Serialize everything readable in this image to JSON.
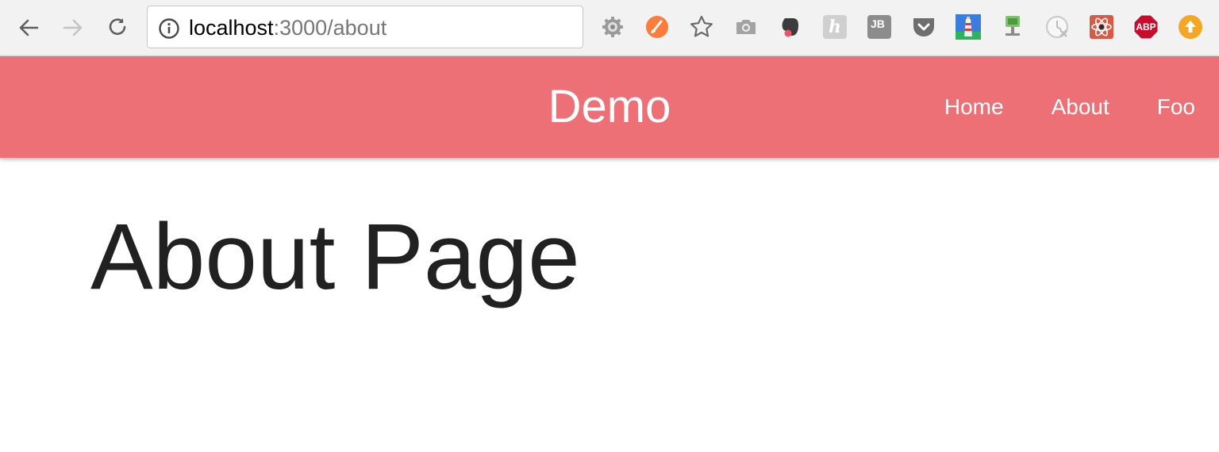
{
  "browser": {
    "url_host": "localhost",
    "url_rest": ":3000/about",
    "extensions": [
      {
        "icon": "settings-gear-icon"
      },
      {
        "icon": "orange-brush-icon",
        "color": "#fc7c3c"
      },
      {
        "icon": "star-bookmark-icon"
      },
      {
        "icon": "camera-icon"
      },
      {
        "icon": "evernote-elephant-icon"
      },
      {
        "icon": "honey-h-icon",
        "label": "h"
      },
      {
        "icon": "jetbrains-icon",
        "label": "JB"
      },
      {
        "icon": "pocket-icon"
      },
      {
        "icon": "lighthouse-icon"
      },
      {
        "icon": "network-monitor-icon"
      },
      {
        "icon": "clock-disabled-icon"
      },
      {
        "icon": "react-devtools-icon"
      },
      {
        "icon": "adblock-plus-icon",
        "label": "ABP"
      },
      {
        "icon": "upload-arrow-icon",
        "color": "#f5a623"
      }
    ]
  },
  "app": {
    "brand": "Demo",
    "nav": [
      "Home",
      "About",
      "Foo"
    ],
    "accent": "#ec7076"
  },
  "page": {
    "heading": "About Page"
  }
}
